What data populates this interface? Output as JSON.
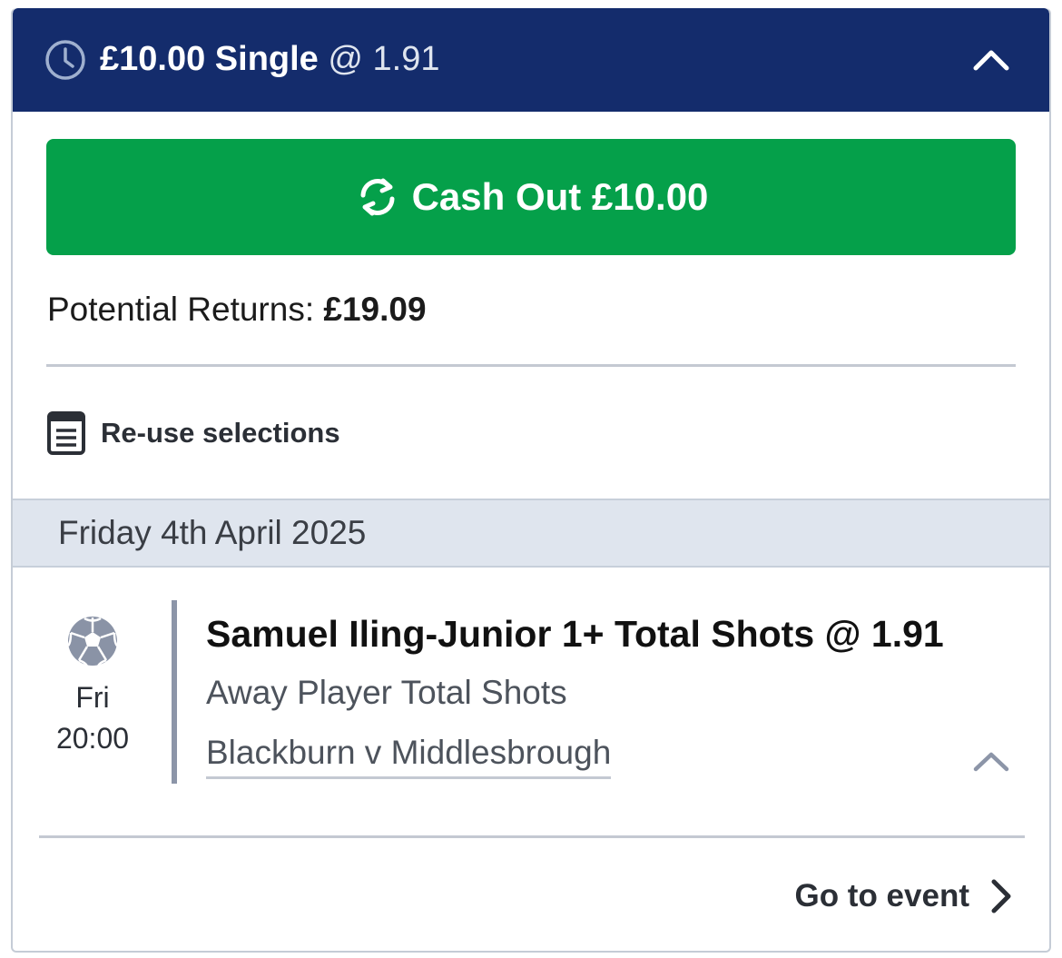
{
  "header": {
    "stake": "£10.00 Single",
    "odds": "@ 1.91"
  },
  "cashout": {
    "label": "Cash Out £10.00"
  },
  "returns": {
    "label": "Potential Returns:",
    "value": "£19.09"
  },
  "reuse": {
    "label": "Re-use selections"
  },
  "date": {
    "label": "Friday 4th April 2025"
  },
  "selection": {
    "day": "Fri",
    "time": "20:00",
    "title": "Samuel Iling-Junior 1+ Total Shots @ 1.91",
    "market": "Away Player Total Shots",
    "event": "Blackburn v Middlesbrough",
    "sport_icon": "football-icon"
  },
  "footer": {
    "goto_label": "Go to event"
  },
  "colors": {
    "header_bg": "#142c6c",
    "cashout_bg": "#05a04a",
    "date_bar_bg": "#dfe5ee"
  }
}
